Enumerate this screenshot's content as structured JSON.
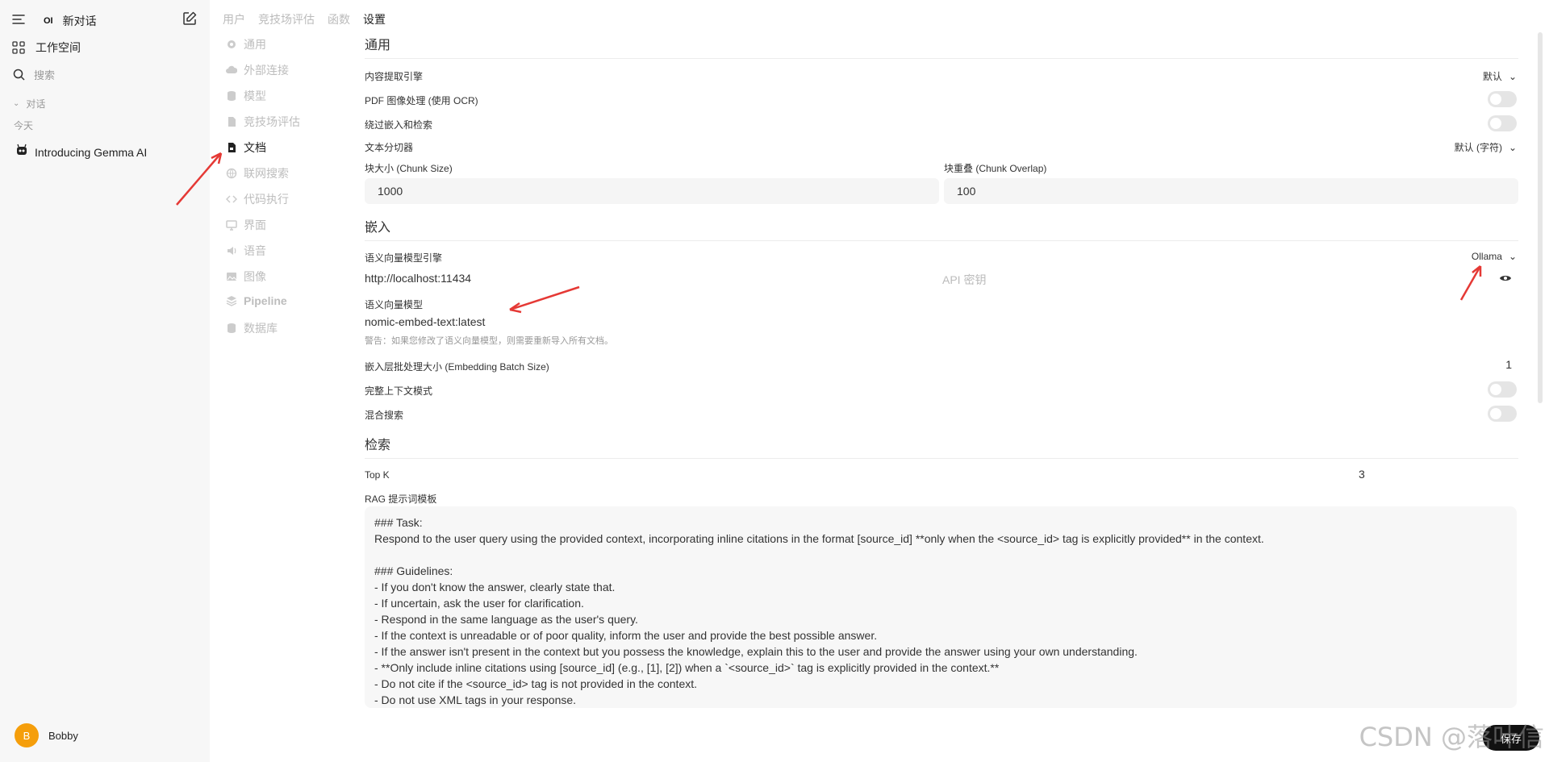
{
  "sidebar": {
    "brand": "OI",
    "new_chat": "新对话",
    "workspace": "工作空间",
    "search_placeholder": "搜索",
    "section": "对话",
    "today": "今天",
    "chat_item": "Introducing Gemma AI",
    "user_initial": "B",
    "user_name": "Bobby"
  },
  "tabs": [
    "用户",
    "竞技场评估",
    "函数",
    "设置"
  ],
  "subnav": [
    "通用",
    "外部连接",
    "模型",
    "竞技场评估",
    "文档",
    "联网搜索",
    "代码执行",
    "界面",
    "语音",
    "图像",
    "Pipeline",
    "数据库"
  ],
  "general": {
    "title": "通用",
    "content_engine_label": "内容提取引擎",
    "content_engine_value": "默认",
    "pdf_ocr_label": "PDF 图像处理 (使用 OCR)",
    "bypass_label": "绕过嵌入和检索",
    "splitter_label": "文本分切器",
    "splitter_value": "默认 (字符)",
    "chunk_size_label": "块大小 (Chunk Size)",
    "chunk_size_value": "1000",
    "chunk_overlap_label": "块重叠 (Chunk Overlap)",
    "chunk_overlap_value": "100"
  },
  "embedding": {
    "title": "嵌入",
    "engine_label": "语义向量模型引擎",
    "engine_value": "Ollama",
    "url": "http://localhost:11434",
    "api_key_placeholder": "API 密钥",
    "model_label": "语义向量模型",
    "model_value": "nomic-embed-text:latest",
    "warning": "警告：如果您修改了语义向量模型，则需要重新导入所有文档。",
    "batch_label": "嵌入层批处理大小 (Embedding Batch Size)",
    "batch_value": "1",
    "full_context_label": "完整上下文模式",
    "hybrid_label": "混合搜索"
  },
  "retrieval": {
    "title": "检索",
    "topk_label": "Top K",
    "topk_value": "3",
    "rag_label": "RAG 提示词模板",
    "rag_template": "### Task:\nRespond to the user query using the provided context, incorporating inline citations in the format [source_id] **only when the <source_id> tag is explicitly provided** in the context.\n\n### Guidelines:\n- If you don't know the answer, clearly state that.\n- If uncertain, ask the user for clarification.\n- Respond in the same language as the user's query.\n- If the context is unreadable or of poor quality, inform the user and provide the best possible answer.\n- If the answer isn't present in the context but you possess the knowledge, explain this to the user and provide the answer using your own understanding.\n- **Only include inline citations using [source_id] (e.g., [1], [2]) when a `<source_id>` tag is explicitly provided in the context.**\n- Do not cite if the <source_id> tag is not provided in the context.\n- Do not use XML tags in your response."
  },
  "save_label": "保存",
  "watermark": "CSDN @落叶信",
  "colors": {
    "accent": "#111111",
    "arrow": "#e53935",
    "avatar": "#f59e0b"
  }
}
